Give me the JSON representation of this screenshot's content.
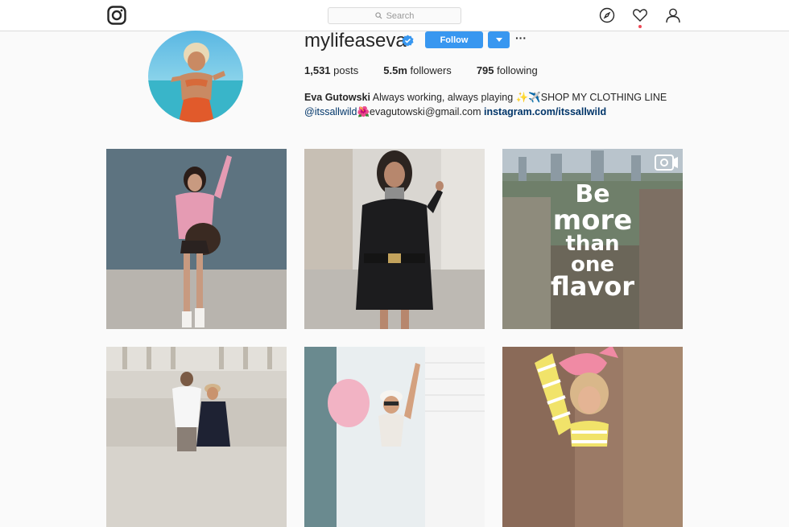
{
  "header": {
    "search_placeholder": "Search",
    "icons": [
      "instagram-logo-icon",
      "compass-icon",
      "heart-icon",
      "person-icon"
    ]
  },
  "profile": {
    "username": "mylifeaseva",
    "verified": true,
    "follow_label": "Follow",
    "stats": {
      "posts_count": "1,531",
      "posts_label": "posts",
      "followers_count": "5.5m",
      "followers_label": "followers",
      "following_count": "795",
      "following_label": "following"
    },
    "bio": {
      "full_name": "Eva Gutowski",
      "line1_text": " Always working, always playing ✨✈️SHOP MY CLOTHING LINE",
      "mention": "@itssallwild",
      "line2_text": "🌺evagutowski@gmail.com ",
      "link": "instagram.com/itssallwild"
    }
  },
  "posts": [
    {
      "id": "post-1",
      "text": ""
    },
    {
      "id": "post-2",
      "text": ""
    },
    {
      "id": "post-3",
      "text": "Be more than one flavor",
      "video": true
    },
    {
      "id": "post-4",
      "text": ""
    },
    {
      "id": "post-5",
      "text": ""
    },
    {
      "id": "post-6",
      "text": ""
    }
  ],
  "colors": {
    "accent": "#3897f0",
    "link": "#003569",
    "notification": "#ed4956"
  }
}
